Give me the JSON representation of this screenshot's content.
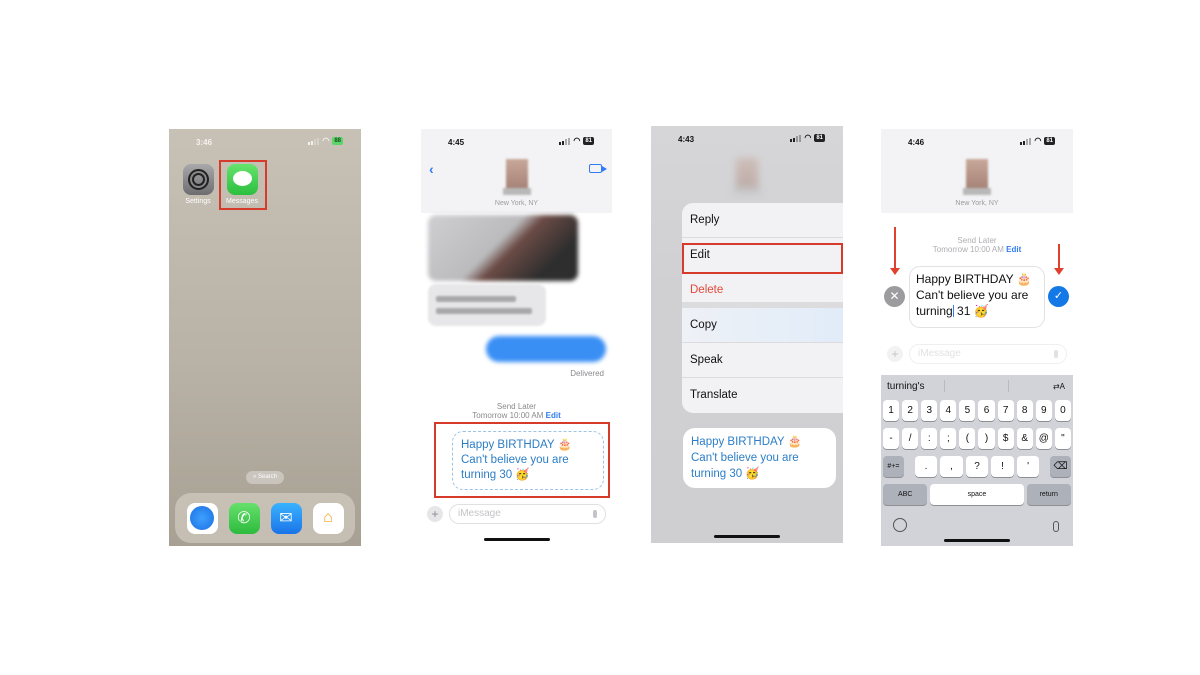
{
  "colors": {
    "highlight_red": "#d63a2a",
    "ios_blue": "#2f7cf6",
    "destructive_red": "#e0493a",
    "scheduled_text_blue": "#2c7ec7",
    "confirm_blue": "#1479e6"
  },
  "panel1": {
    "status": {
      "time": "3:46",
      "battery": "88"
    },
    "apps": [
      {
        "label": "Settings",
        "icon": "settings-icon"
      },
      {
        "label": "Messages",
        "icon": "messages-icon",
        "highlighted": true
      }
    ],
    "search_label": "Search",
    "dock": [
      "safari-icon",
      "phone-icon",
      "mail-icon",
      "home-app-icon"
    ]
  },
  "panel2": {
    "status": {
      "time": "4:45",
      "battery": "81"
    },
    "back_glyph": "‹",
    "contact_location": "New York, NY",
    "delivered_label": "Delivered",
    "send_later_label": "Send Later",
    "scheduled_time": "Tomorrow 10:00 AM",
    "edit_label": "Edit",
    "scheduled_message": "Happy BIRTHDAY 🎂 Can't believe you are turning 30 🥳",
    "input_placeholder": "iMessage",
    "plus_glyph": "+"
  },
  "panel3": {
    "status": {
      "time": "4:43",
      "battery": "81"
    },
    "menu_items": [
      {
        "label": "Reply"
      },
      {
        "label": "Edit",
        "highlighted": true
      },
      {
        "label": "Delete",
        "destructive": true
      },
      {
        "label": "Copy"
      },
      {
        "label": "Speak"
      },
      {
        "label": "Translate"
      }
    ],
    "message": "Happy BIRTHDAY 🎂 Can't believe you are turning 30 🥳"
  },
  "panel4": {
    "status": {
      "time": "4:46",
      "battery": "81"
    },
    "contact_location": "New York, NY",
    "send_later_label": "Send Later",
    "scheduled_time": "Tomorrow 10:00 AM",
    "edit_label": "Edit",
    "edit_text_before_caret": "Happy BIRTHDAY 🎂 Can't believe you are turning",
    "edit_text_after_caret": " 31 🥳",
    "cancel_glyph": "✕",
    "confirm_glyph": "✓",
    "input_placeholder": "iMessage",
    "plus_glyph": "+",
    "keyboard": {
      "suggestion": "turning's",
      "translate_glyph": "⇄A",
      "row1": [
        "1",
        "2",
        "3",
        "4",
        "5",
        "6",
        "7",
        "8",
        "9",
        "0"
      ],
      "row2": [
        "-",
        "/",
        ":",
        ";",
        "(",
        ")",
        "$",
        "&",
        "@",
        "\""
      ],
      "row3_left": "#+=",
      "row3": [
        ".",
        ",",
        "?",
        "!",
        "'"
      ],
      "backspace_glyph": "⌫",
      "abc_label": "ABC",
      "space_label": "space",
      "return_label": "return"
    }
  }
}
